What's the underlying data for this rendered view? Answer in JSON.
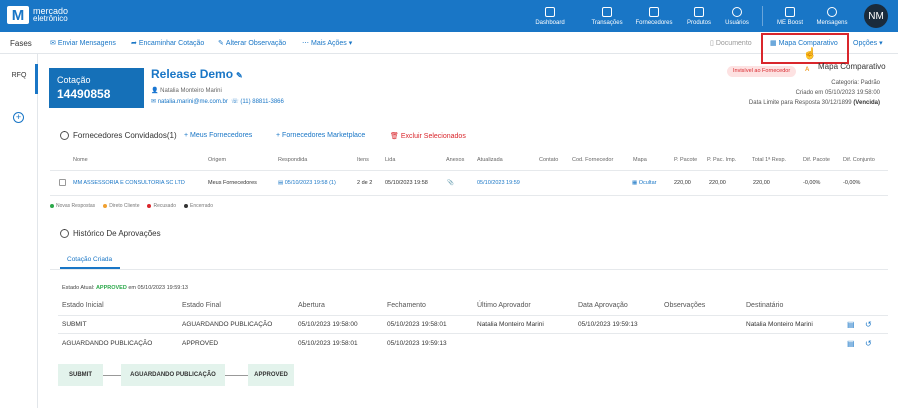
{
  "topbar": {
    "brand_line1": "mercado",
    "brand_line2": "eletrônico",
    "nav": [
      "Dashboard",
      "Transações",
      "Fornecedores",
      "Produtos",
      "Usuários",
      "ME Boost",
      "Mensagens"
    ],
    "avatar_initials": "NM"
  },
  "toolbar": {
    "fases": "Fases",
    "enviar": "Enviar Mensagens",
    "encaminhar": "Encaminhar Cotação",
    "alterar": "Alterar Observação",
    "mais": "Mais Ações",
    "documento": "Documento",
    "mapa": "Mapa Comparativo",
    "opcoes": "Opções",
    "tooltip": "Mapa Comparativo"
  },
  "rail": {
    "rfq": "RFQ"
  },
  "header": {
    "cotacao_label": "Cotação",
    "cotacao_number": "14490858",
    "title": "Release Demo",
    "user": "Natalia Monteiro Marini",
    "email": "natalia.marini@me.com.br",
    "phone": "(11) 88811-3866",
    "badge": "Invisível ao Fornecedor",
    "categoria": "Categoria: Padrão",
    "criado": "Criado em 05/10/2023 19:58:00",
    "limite_label": "Data Limite para Resposta 30/12/1899",
    "limite_status": "(Vencida)"
  },
  "fornecedores": {
    "title": "Fornecedores Convidados(1)",
    "meus": "Meus Fornecedores",
    "marketplace": "Fornecedores Marketplace",
    "excluir": "Excluir Selecionados",
    "columns": [
      "Nome",
      "Origem",
      "Respondida",
      "Itens",
      "Lida",
      "Anexos",
      "Atualizada",
      "Contato",
      "Cod. Fornecedor",
      "Mapa",
      "P. Pacote",
      "P. Pac. Imp.",
      "Total 1ª Resp.",
      "Dif. Pacote",
      "Dif. Conjunto"
    ],
    "row": {
      "nome": "MM ASSESSORIA E CONSULTORIA SC LTD",
      "origem": "Meus Fornecedores",
      "respondida": "05/10/2023 19:58 (1)",
      "itens": "2 de 2",
      "lida": "05/10/2023 19:58",
      "atualizada": "05/10/2023 19:59",
      "mapa": "Ocultar",
      "p_pacote": "220,00",
      "p_pac_imp": "220,00",
      "total": "220,00",
      "dif_pacote": "-0,00%",
      "dif_conjunto": "-0,00%"
    },
    "legend": [
      "Novas Respostas",
      "Direto Cliente",
      "Recusado",
      "Encerrado"
    ],
    "legend_colors": [
      "#2ba84a",
      "#f0a030",
      "#d9262c",
      "#333333"
    ]
  },
  "historico": {
    "title": "Histórico De Aprovações",
    "tab": "Cotação Criada",
    "status_prefix": "Estado Atual:",
    "status_value": "APPROVED",
    "status_suffix": "em 05/10/2023 19:59:13",
    "columns": [
      "Estado Inicial",
      "Estado Final",
      "Abertura",
      "Fechamento",
      "Último Aprovador",
      "Data Aprovação",
      "Observações",
      "Destinatário"
    ],
    "rows": [
      {
        "inicial": "SUBMIT",
        "final": "AGUARDANDO PUBLICAÇÃO",
        "abertura": "05/10/2023 19:58:00",
        "fechamento": "05/10/2023 19:58:01",
        "aprovador": "Natalia Monteiro Marini",
        "data": "05/10/2023 19:59:13",
        "obs": "",
        "destinatario": "Natalia Monteiro Marini"
      },
      {
        "inicial": "AGUARDANDO PUBLICAÇÃO",
        "final": "APPROVED",
        "abertura": "05/10/2023 19:58:01",
        "fechamento": "05/10/2023 19:59:13",
        "aprovador": "",
        "data": "",
        "obs": "",
        "destinatario": ""
      }
    ],
    "flow": [
      "SUBMIT",
      "AGUARDANDO PUBLICAÇÃO",
      "APPROVED"
    ]
  }
}
